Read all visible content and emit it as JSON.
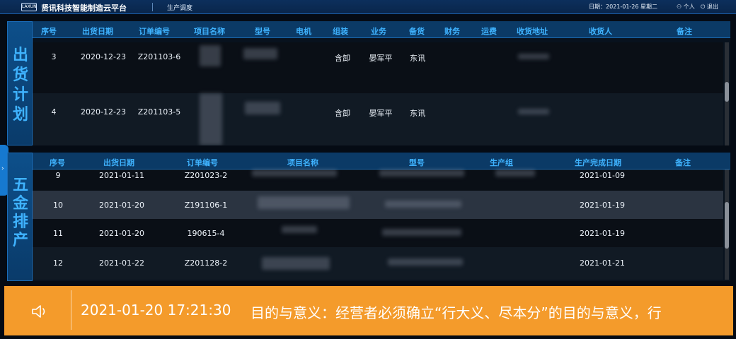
{
  "header": {
    "logo_text": "LAXUN",
    "brand": "贤讯科技智能制造云平台",
    "module": "生产调度",
    "date": "日期：2021-01-26 星期二",
    "user_label": "个人",
    "logout_label": "退出"
  },
  "shipping": {
    "side_chars": [
      "出",
      "货",
      "计",
      "划"
    ],
    "columns": [
      "序号",
      "出货日期",
      "订单编号",
      "项目名称",
      "型号",
      "电机",
      "组装",
      "业务",
      "备货",
      "财务",
      "运费",
      "收货地址",
      "收货人",
      "备注"
    ],
    "rows": [
      {
        "no": "3",
        "date": "2020-12-23",
        "order": "Z201103-6",
        "assembly": "含卸",
        "sales": "晏军平",
        "stock": "东讯"
      },
      {
        "no": "4",
        "date": "2020-12-23",
        "order": "Z201103-5",
        "assembly": "含卸",
        "sales": "晏军平",
        "stock": "东讯"
      }
    ]
  },
  "hardware": {
    "side_chars": [
      "五",
      "金",
      "排",
      "产"
    ],
    "columns": [
      "序号",
      "出货日期",
      "订单编号",
      "项目名称",
      "型号",
      "生产组",
      "生产完成日期",
      "备注"
    ],
    "rows": [
      {
        "no": "9",
        "date": "2021-01-11",
        "order": "Z201023-2",
        "done": "2021-01-09"
      },
      {
        "no": "10",
        "date": "2021-01-20",
        "order": "Z191106-1",
        "done": "2021-01-19"
      },
      {
        "no": "11",
        "date": "2021-01-20",
        "order": "190615-4",
        "done": "2021-01-19"
      },
      {
        "no": "12",
        "date": "2021-01-22",
        "order": "Z201128-2",
        "done": "2021-01-21"
      }
    ]
  },
  "ticker": {
    "time": "2021-01-20 17:21:30",
    "message": "目的与意义：经营者必须确立“行大义、尽本分”的目的与意义，行"
  },
  "colors": {
    "accent": "#3fb3ff",
    "header_bg": "#0b3a66",
    "ticker_bg": "#f49b2b"
  },
  "icons": [
    "user-icon",
    "power-icon",
    "speaker-icon",
    "chevron-right-icon"
  ]
}
